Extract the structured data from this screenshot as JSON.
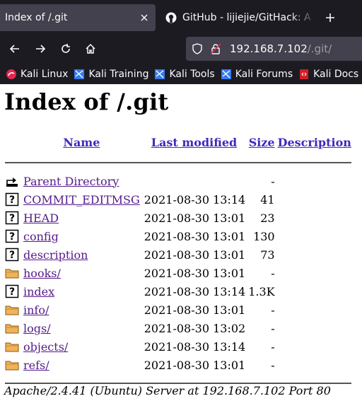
{
  "browser": {
    "tabs": [
      {
        "title": "Index of /.git",
        "active": true
      },
      {
        "title": "GitHub - lijiejie/GitHack: A",
        "active": false
      }
    ],
    "url": {
      "host": "192.168.7.102",
      "path": "/.git/"
    },
    "bookmarks": [
      {
        "label": "Kali Linux",
        "icon": "kali-linux-icon"
      },
      {
        "label": "Kali Training",
        "icon": "kali-training-icon"
      },
      {
        "label": "Kali Tools",
        "icon": "kali-tools-icon"
      },
      {
        "label": "Kali Forums",
        "icon": "kali-forums-icon"
      },
      {
        "label": "Kali Docs",
        "icon": "kali-docs-icon"
      }
    ]
  },
  "page": {
    "title": "Index of /.git",
    "columns": {
      "name": "Name",
      "modified": "Last modified",
      "size": "Size",
      "description": "Description"
    },
    "parent": {
      "name": "Parent Directory",
      "size": "-"
    },
    "entries": [
      {
        "name": "COMMIT_EDITMSG",
        "modified": "2021-08-30 13:14",
        "size": "41",
        "type": "file"
      },
      {
        "name": "HEAD",
        "modified": "2021-08-30 13:01",
        "size": "23",
        "type": "file"
      },
      {
        "name": "config",
        "modified": "2021-08-30 13:01",
        "size": "130",
        "type": "file"
      },
      {
        "name": "description",
        "modified": "2021-08-30 13:01",
        "size": "73",
        "type": "file"
      },
      {
        "name": "hooks/",
        "modified": "2021-08-30 13:01",
        "size": "-",
        "type": "folder"
      },
      {
        "name": "index",
        "modified": "2021-08-30 13:14",
        "size": "1.3K",
        "type": "file"
      },
      {
        "name": "info/",
        "modified": "2021-08-30 13:01",
        "size": "-",
        "type": "folder"
      },
      {
        "name": "logs/",
        "modified": "2021-08-30 13:02",
        "size": "-",
        "type": "folder"
      },
      {
        "name": "objects/",
        "modified": "2021-08-30 13:14",
        "size": "-",
        "type": "folder"
      },
      {
        "name": "refs/",
        "modified": "2021-08-30 13:01",
        "size": "-",
        "type": "folder"
      }
    ],
    "footer": "Apache/2.4.41 (Ubuntu) Server at 192.168.7.102 Port 80"
  },
  "colors": {
    "chrome": "#1c1b22",
    "tab_active": "#42414d",
    "link": "#551a8b",
    "header_link": "#3d2bbd"
  }
}
